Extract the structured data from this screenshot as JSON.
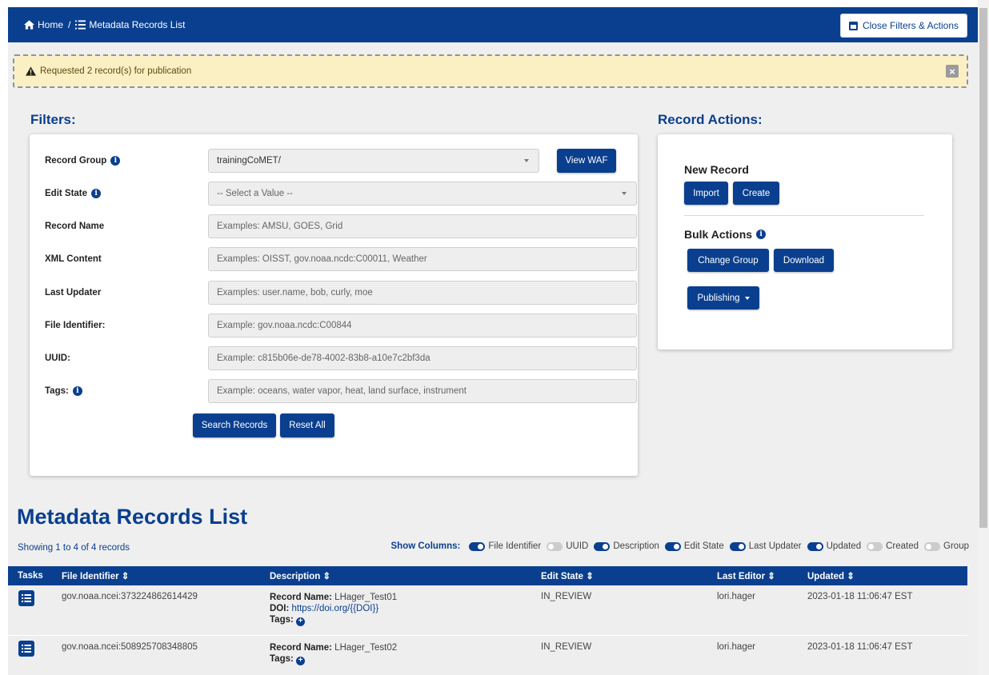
{
  "breadcrumb": {
    "home": "Home",
    "separator": "/",
    "current": "Metadata Records List"
  },
  "header": {
    "close_button": "Close Filters & Actions"
  },
  "alert": {
    "message": "Requested 2 record(s) for publication",
    "close": "×"
  },
  "filters": {
    "title": "Filters:",
    "fields": [
      {
        "label": "Record Group",
        "value": "trainingCoMET/",
        "placeholder": ""
      },
      {
        "label": "Edit State",
        "value": "-- Select a Value --",
        "placeholder": ""
      },
      {
        "label": "Record Name",
        "value": "",
        "placeholder": "Examples: AMSU, GOES, Grid"
      },
      {
        "label": "XML Content",
        "value": "",
        "placeholder": "Examples: OISST, gov.noaa.ncdc:C00011, Weather"
      },
      {
        "label": "Last Updater",
        "value": "",
        "placeholder": "Examples: user.name, bob, curly, moe"
      },
      {
        "label": "File Identifier:",
        "value": "",
        "placeholder": "Example: gov.noaa.ncdc:C00844"
      },
      {
        "label": "UUID:",
        "value": "",
        "placeholder": "Example: c815b06e-de78-4002-83b8-a10e7c2bf3da"
      },
      {
        "label": "Tags:",
        "value": "",
        "placeholder": "Example: oceans, water vapor, heat, land surface, instrument"
      }
    ],
    "view_waf": "View WAF",
    "search_button": "Search Records",
    "reset_button": "Reset All"
  },
  "record_actions": {
    "title": "Record Actions:",
    "new_record": "New Record",
    "import": "Import",
    "create": "Create",
    "bulk_actions": "Bulk Actions",
    "change_group": "Change Group",
    "download": "Download",
    "publishing": "Publishing"
  },
  "list": {
    "title": "Metadata Records List",
    "showing": "Showing 1 to 4 of 4 records",
    "show_columns_label": "Show Columns:",
    "columns": [
      {
        "name": "File Identifier",
        "on": true
      },
      {
        "name": "UUID",
        "on": false
      },
      {
        "name": "Description",
        "on": true
      },
      {
        "name": "Edit State",
        "on": true
      },
      {
        "name": "Last Updater",
        "on": true
      },
      {
        "name": "Updated",
        "on": true
      },
      {
        "name": "Created",
        "on": false
      },
      {
        "name": "Group",
        "on": false
      }
    ]
  },
  "table": {
    "headers": {
      "tasks": "Tasks",
      "file_identifier": "File Identifier ⇕",
      "description": "Description ⇕",
      "edit_state": "Edit State ⇕",
      "last_editor": "Last Editor ⇕",
      "updated": "Updated ⇕"
    },
    "rows": [
      {
        "file_identifier": "gov.noaa.ncei:373224862614429",
        "record_name_label": "Record Name:",
        "record_name": "LHager_Test01",
        "doi_label": "DOI:",
        "doi": "https://doi.org/{{DOI}}",
        "tags_label": "Tags:",
        "edit_state": "IN_REVIEW",
        "last_editor": "lori.hager",
        "updated": "2023-01-18 11:06:47 EST"
      },
      {
        "file_identifier": "gov.noaa.ncei:508925708348805",
        "record_name_label": "Record Name:",
        "record_name": "LHager_Test02",
        "tags_label": "Tags:",
        "edit_state": "IN_REVIEW",
        "last_editor": "lori.hager",
        "updated": "2023-01-18 11:06:47 EST"
      }
    ]
  },
  "colors": {
    "primary": "#0a3f8f",
    "alert_bg": "#fbf0c3",
    "page_bg": "#efefef"
  },
  "icons": {
    "home": "home-icon",
    "list": "list-icon",
    "close_box": "close-box-icon",
    "warning": "warning-icon",
    "info": "info-icon",
    "tasks": "tasks-icon",
    "plus": "plus-circle-icon"
  }
}
